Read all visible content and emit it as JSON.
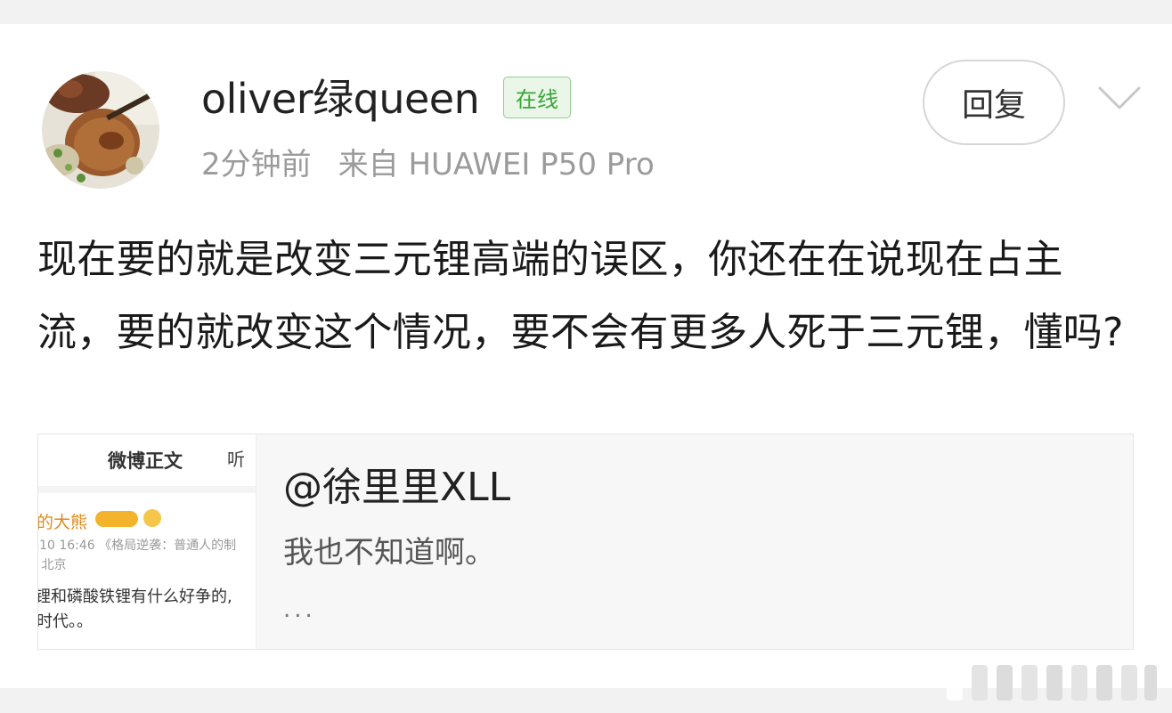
{
  "post": {
    "username": "oliver绿queen",
    "online_badge": "在线",
    "time": "2分钟前",
    "source": "来自 HUAWEI P50 Pro",
    "reply_label": "回复",
    "content": "现在要的就是改变三元锂高端的误区，你还在在说现在占主流，要的就改变这个情况，要不会有更多人死于三元锂，懂吗?"
  },
  "quote": {
    "author": "@徐里里XLL",
    "text": "我也不知道啊。",
    "more": "...",
    "thumbnail": {
      "title": "微博正文",
      "icon": "听",
      "name": "的大熊",
      "line1": "-10 16:46 《格局逆袭：普通人的制",
      "line2": "- 北京",
      "line3": "锂和磷酸铁锂有什么好争的,",
      "line4": "时代。。"
    }
  },
  "colors": {
    "page_background": "#f2f2f2",
    "online_badge_green": "#3aa53a",
    "meta_gray": "#9b9b9b"
  },
  "icons": {
    "chevron": "chevron-down-icon",
    "avatar": "avatar-food-photo"
  }
}
